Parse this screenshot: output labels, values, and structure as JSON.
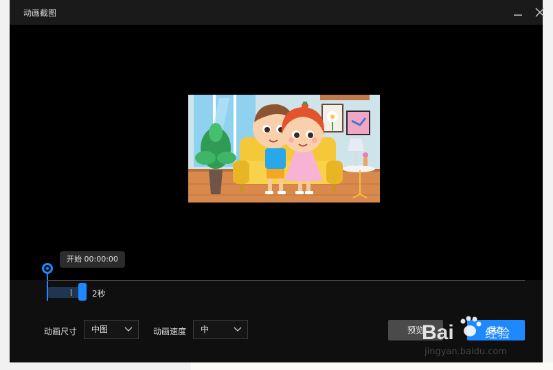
{
  "window": {
    "title": "动画截图",
    "minimize_icon": "minimize-icon",
    "close_icon": "close-icon"
  },
  "timeline": {
    "start_tooltip": "开始 00:00:00",
    "duration_label": "2秒"
  },
  "settings": {
    "size_label": "动画尺寸",
    "size_value": "中图",
    "speed_label": "动画速度",
    "speed_value": "中"
  },
  "actions": {
    "preview_label": "预览",
    "save_label": "保存"
  },
  "watermark": {
    "brand": "Bai",
    "brand_tail": "经验",
    "url": "jingyan.baidu.com"
  },
  "colors": {
    "accent": "#1e88ff",
    "dialog_bg": "#0f0f0f",
    "titlebar_bg": "#1a1a1a"
  }
}
